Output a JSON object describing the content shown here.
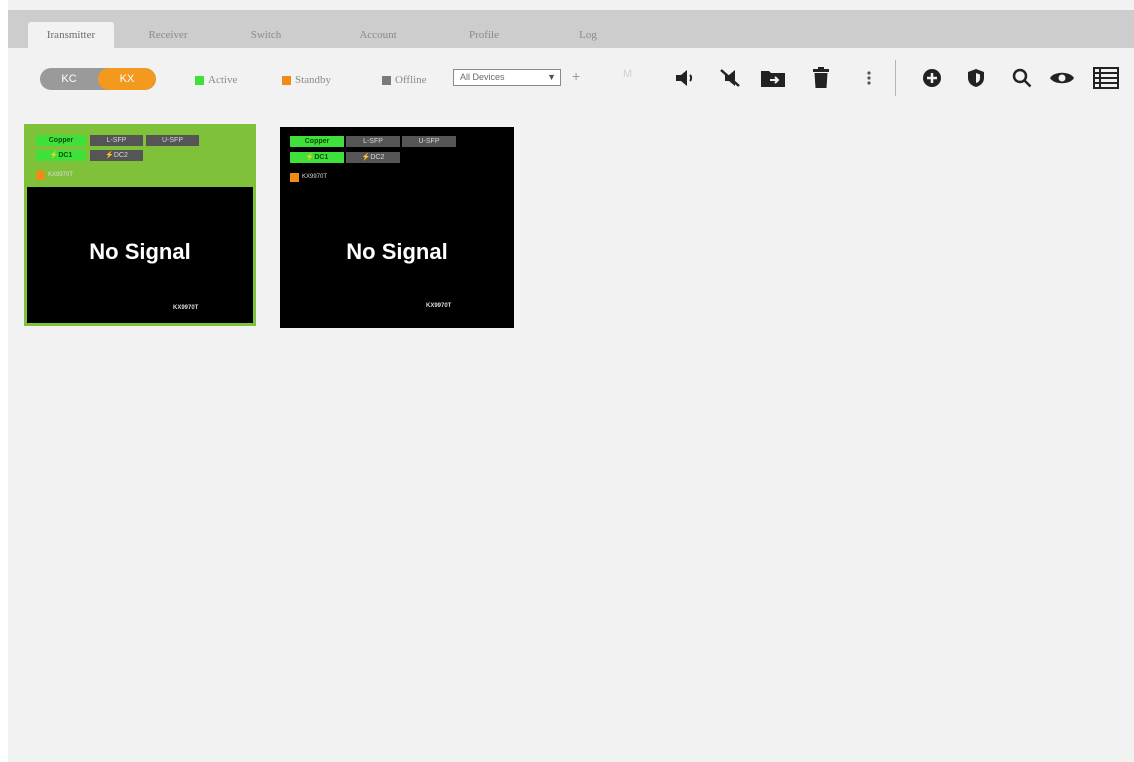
{
  "tabs": [
    {
      "label": "Iransmitter",
      "active": true
    },
    {
      "label": "Receiver",
      "active": false
    },
    {
      "label": "Switch",
      "active": false
    },
    {
      "label": "Account",
      "active": false
    },
    {
      "label": "Profile",
      "active": false
    },
    {
      "label": "Log",
      "active": false
    }
  ],
  "toolbar": {
    "mode_kc": "KC",
    "mode_kx": "KX",
    "legend_active": "Active",
    "legend_standby": "Standby",
    "legend_offline": "Offline",
    "device_select_value": "All Devices",
    "plus_label": "+",
    "faint_label": "M"
  },
  "colors": {
    "active": "#3fe03a",
    "standby": "#f28a16",
    "offline": "#7a7a7a",
    "selected_card_border": "#7fc23a"
  },
  "icons": [
    "speaker-icon",
    "mute-icon",
    "folder-import-icon",
    "trash-icon",
    "more-vertical-icon",
    "add-circle-icon",
    "shield-icon",
    "search-icon",
    "eye-icon",
    "list-view-icon"
  ],
  "cards": [
    {
      "selected": true,
      "badge_copper": "Copper",
      "badge_lsfp": "L-SFP",
      "badge_usfp": "U-SFP",
      "badge_dc1": "⚡DC1",
      "badge_dc2": "⚡DC2",
      "model": "KX9970T",
      "signal": "No Signal",
      "footer_model": "KX9970T"
    },
    {
      "selected": false,
      "badge_copper": "Copper",
      "badge_lsfp": "L-SFP",
      "badge_usfp": "U-SFP",
      "badge_dc1": "⚡DC1",
      "badge_dc2": "⚡DC2",
      "model": "KX9970T",
      "signal": "No Signal",
      "footer_model": "KX9970T"
    }
  ]
}
